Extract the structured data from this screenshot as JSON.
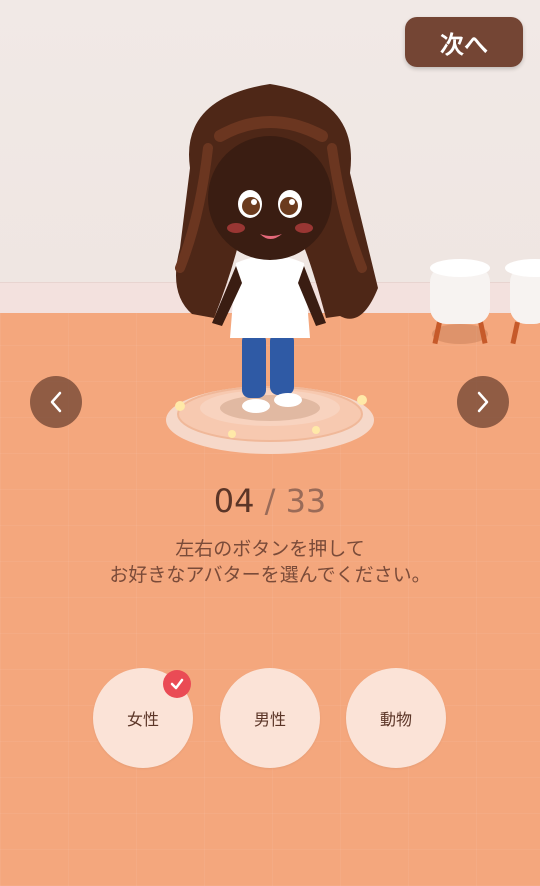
{
  "header": {
    "next_label": "次へ"
  },
  "counter": {
    "current": "04",
    "separator": "/",
    "total": "33"
  },
  "instructions": {
    "line1": "左右のボタンを押して",
    "line2": "お好きなアバターを選んでください。"
  },
  "categories": [
    {
      "label": "女性",
      "selected": true
    },
    {
      "label": "男性",
      "selected": false
    },
    {
      "label": "動物",
      "selected": false
    }
  ],
  "colors": {
    "accent": "#744534",
    "floor": "#f4a77d",
    "check": "#ea4b55",
    "option_bg": "#fbe3d7"
  },
  "icons": {
    "prev": "chevron-left-icon",
    "next": "chevron-right-icon",
    "selected": "checkmark-icon"
  }
}
